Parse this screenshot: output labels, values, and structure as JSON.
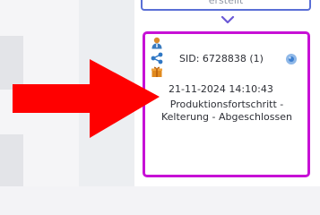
{
  "previous_card": {
    "label": "erstellt"
  },
  "card": {
    "icons": [
      "user-icon",
      "share-icon",
      "gift-icon",
      "status-circle-icon"
    ],
    "sid": "SID: 6728838 (1)",
    "datetime": "21-11-2024 14:10:43",
    "status_line1": "Produktionsfortschritt -",
    "status_line2": "Kelterung - Abgeschlossen"
  },
  "colors": {
    "card_border": "#c711d6",
    "prev_card_border": "#5a6fd6",
    "chevron": "#6b59d6",
    "arrow": "#ff0000"
  }
}
